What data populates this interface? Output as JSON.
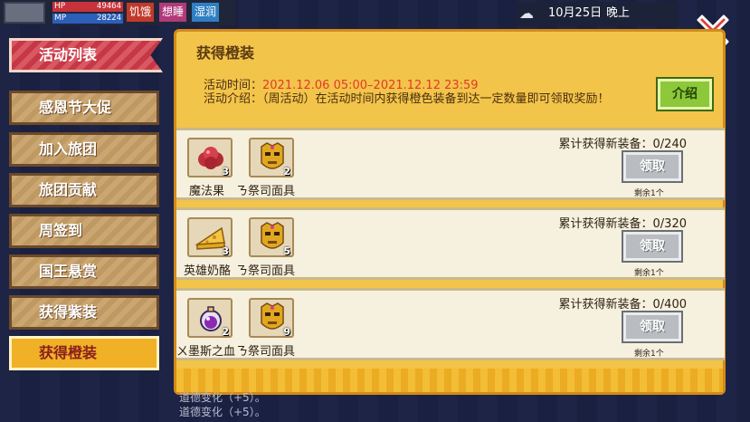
{
  "hud": {
    "hp_label": "HP",
    "hp_value": "49464",
    "mp_label": "MP",
    "mp_value": "28224",
    "status_tags": [
      "饥饿",
      "想睡",
      "湿润"
    ]
  },
  "weather": {
    "icon": "cloud-rain-icon",
    "date": "10月25日",
    "period": "晚上"
  },
  "tabs": {
    "header": "活动列表",
    "items": [
      "感恩节大促",
      "加入旅团",
      "旅团贡献",
      "周签到",
      "国王悬赏",
      "获得紫装",
      "获得橙装"
    ],
    "active_index": 6
  },
  "panel": {
    "title": "获得橙装",
    "time_label": "活动时间：",
    "time_value": "2021.12.06 05:00–2021.12.12 23:59",
    "desc_label": "活动介绍：",
    "desc_text": "（周活动）在活动时间内获得橙色装备到达一定数量即可领取奖励！",
    "intro_button": "介绍"
  },
  "rewards": [
    {
      "progress": "累计获得新装备：0/240",
      "claim_label": "领取",
      "remaining": "剩余1个",
      "items": [
        {
          "name": "魔法果",
          "count": "3",
          "icon": "magic-fruit-icon"
        },
        {
          "name": "ㄋ祭司面具",
          "count": "2",
          "icon": "priest-mask-icon"
        }
      ]
    },
    {
      "progress": "累计获得新装备：0/320",
      "claim_label": "领取",
      "remaining": "剩余1个",
      "items": [
        {
          "name": "英雄奶酪",
          "count": "3",
          "icon": "cheese-icon"
        },
        {
          "name": "ㄋ祭司面具",
          "count": "5",
          "icon": "priest-mask-icon"
        }
      ]
    },
    {
      "progress": "累计获得新装备：0/400",
      "claim_label": "领取",
      "remaining": "剩余1个",
      "items": [
        {
          "name": "ㄨ墨斯之血",
          "count": "2",
          "icon": "blood-potion-icon"
        },
        {
          "name": "ㄋ祭司面具",
          "count": "9",
          "icon": "priest-mask-icon"
        }
      ]
    }
  ],
  "background_text": [
    "道德变化（+5）。",
    "道德变化（+5）。"
  ]
}
